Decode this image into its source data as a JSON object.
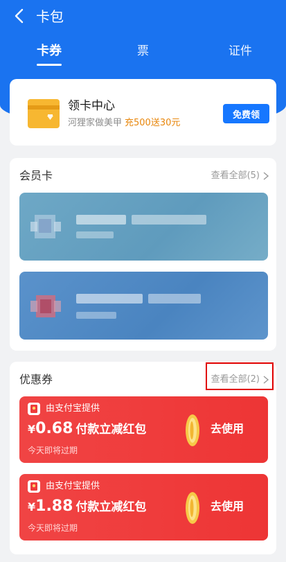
{
  "header": {
    "title": "卡包"
  },
  "tabs": [
    {
      "label": "卡券",
      "active": true
    },
    {
      "label": "票",
      "active": false
    },
    {
      "label": "证件",
      "active": false
    }
  ],
  "claim": {
    "title": "领卡中心",
    "subtitle": "河狸家做美甲",
    "highlight": "充500送30元",
    "button": "免费领",
    "icon": "wallet-card-icon"
  },
  "membership": {
    "title": "会员卡",
    "view_all": "查看全部(5)"
  },
  "coupons": {
    "title": "优惠券",
    "view_all": "查看全部(2)",
    "items": [
      {
        "provider": "由支付宝提供",
        "currency": "¥",
        "amount": "0.68",
        "description": "付款立减红包",
        "expiry": "今天即将过期",
        "action": "去使用"
      },
      {
        "provider": "由支付宝提供",
        "currency": "¥",
        "amount": "1.88",
        "description": "付款立减红包",
        "expiry": "今天即将过期",
        "action": "去使用"
      }
    ]
  },
  "colors": {
    "brand_blue": "#1a73f0",
    "button_blue": "#1677ff",
    "coupon_red": "#ef3b3b",
    "highlight_orange": "#e8860b",
    "annotation_red": "#e00000"
  }
}
